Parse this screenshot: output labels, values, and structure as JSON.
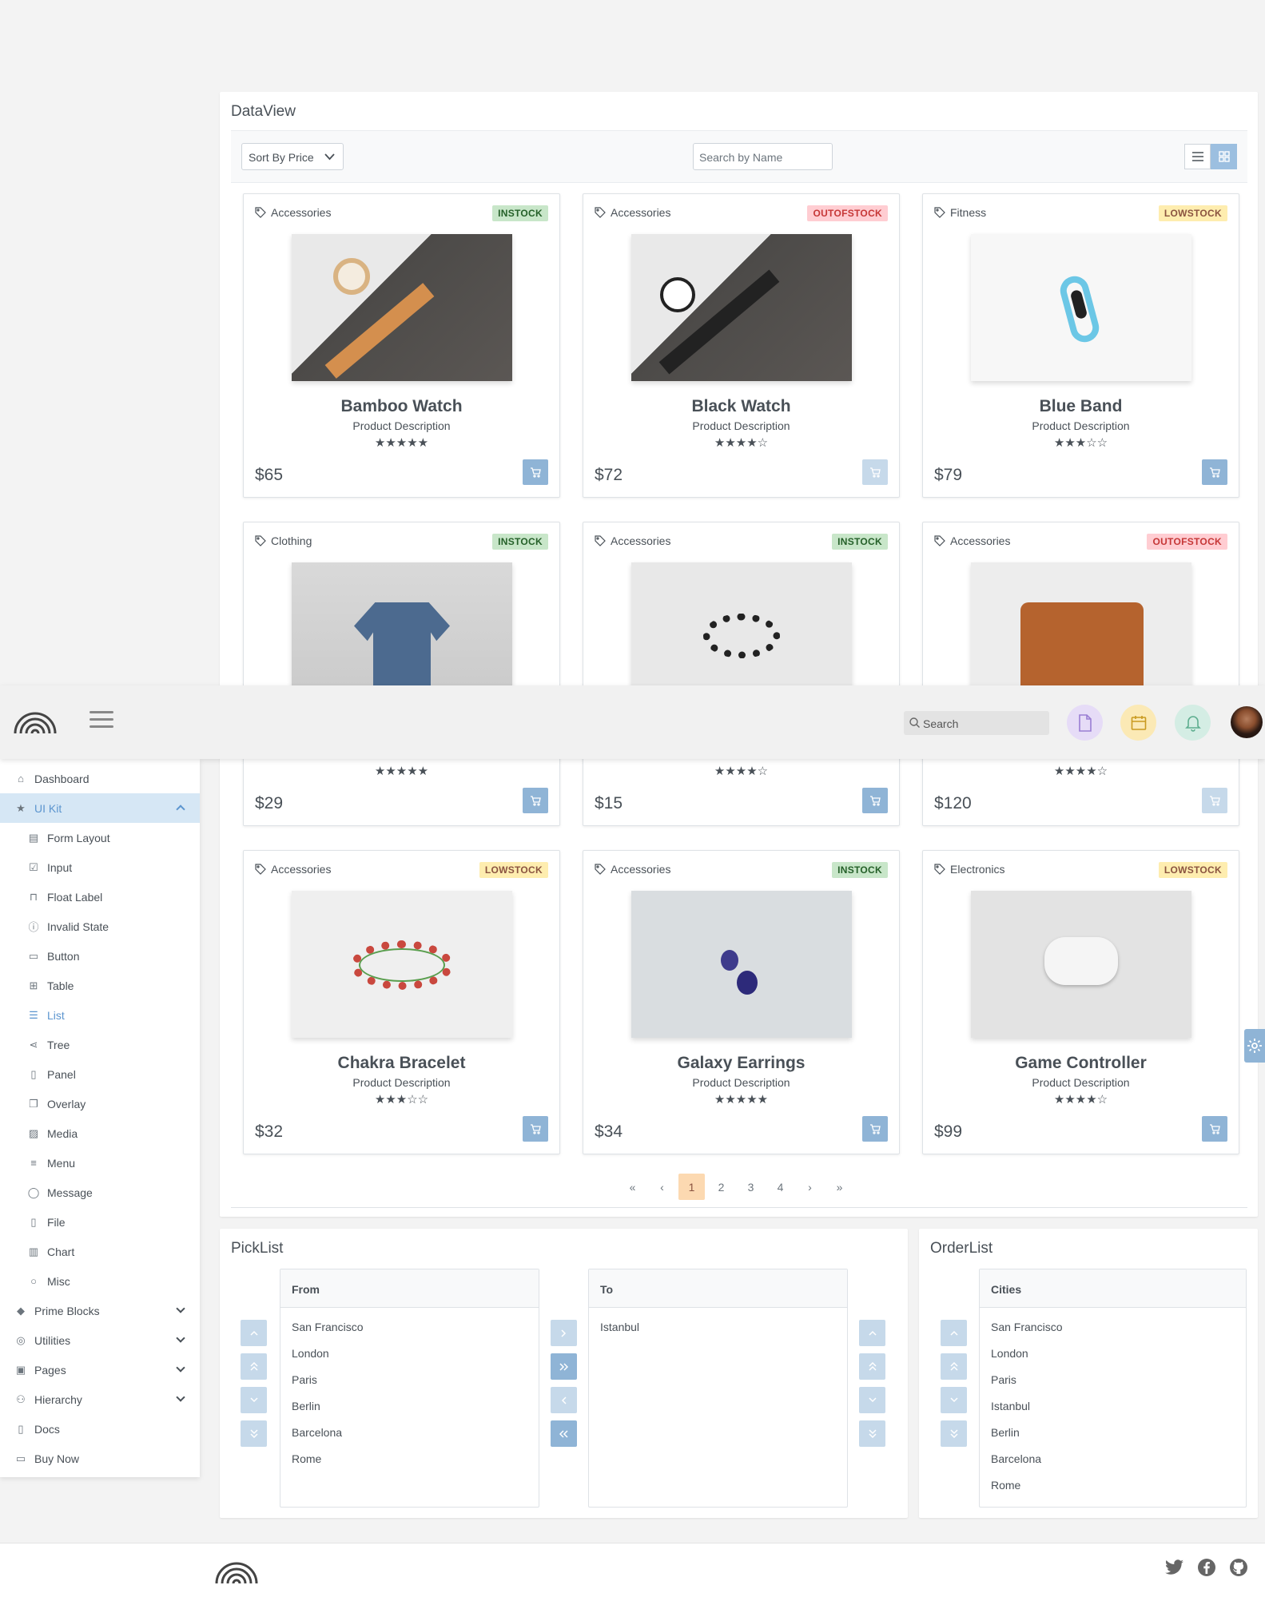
{
  "dataview": {
    "title": "DataView",
    "sort_label": "Sort By Price",
    "search_placeholder": "Search by Name",
    "products": [
      {
        "category": "Accessories",
        "status": "INSTOCK",
        "status_type": "in",
        "name": "Bamboo Watch",
        "description": "Product Description",
        "rating": 5,
        "price": "$65",
        "cart_disabled": false
      },
      {
        "category": "Accessories",
        "status": "OUTOFSTOCK",
        "status_type": "out",
        "name": "Black Watch",
        "description": "Product Description",
        "rating": 4,
        "price": "$72",
        "cart_disabled": true
      },
      {
        "category": "Fitness",
        "status": "LOWSTOCK",
        "status_type": "low",
        "name": "Blue Band",
        "description": "Product Description",
        "rating": 3,
        "price": "$79",
        "cart_disabled": false
      },
      {
        "category": "Clothing",
        "status": "INSTOCK",
        "status_type": "in",
        "name": "",
        "description": "",
        "rating": 5,
        "price": "$29",
        "cart_disabled": false
      },
      {
        "category": "Accessories",
        "status": "INSTOCK",
        "status_type": "in",
        "name": "",
        "description": "",
        "rating": 4,
        "price": "$15",
        "cart_disabled": false
      },
      {
        "category": "Accessories",
        "status": "OUTOFSTOCK",
        "status_type": "out",
        "name": "",
        "description": "",
        "rating": 4,
        "price": "$120",
        "cart_disabled": true
      },
      {
        "category": "Accessories",
        "status": "LOWSTOCK",
        "status_type": "low",
        "name": "Chakra Bracelet",
        "description": "Product Description",
        "rating": 3,
        "price": "$32",
        "cart_disabled": false
      },
      {
        "category": "Accessories",
        "status": "INSTOCK",
        "status_type": "in",
        "name": "Galaxy Earrings",
        "description": "Product Description",
        "rating": 5,
        "price": "$34",
        "cart_disabled": false
      },
      {
        "category": "Electronics",
        "status": "LOWSTOCK",
        "status_type": "low",
        "name": "Game Controller",
        "description": "Product Description",
        "rating": 4,
        "price": "$99",
        "cart_disabled": false
      }
    ],
    "pager": {
      "first": "«",
      "prev": "‹",
      "pages": [
        "1",
        "2",
        "3",
        "4"
      ],
      "current": "1",
      "next": "›",
      "last": "»"
    }
  },
  "topbar": {
    "search_placeholder": "Search"
  },
  "sidebar": {
    "items": [
      {
        "label": "Dashboard",
        "icon": "home-icon",
        "level": 0
      },
      {
        "label": "UI Kit",
        "icon": "star-icon",
        "level": 0,
        "active": true,
        "expandable": true
      },
      {
        "label": "Form Layout",
        "icon": "id-card-icon",
        "level": 1
      },
      {
        "label": "Input",
        "icon": "check-square-icon",
        "level": 1
      },
      {
        "label": "Float Label",
        "icon": "bookmark-icon",
        "level": 1
      },
      {
        "label": "Invalid State",
        "icon": "exclamation-circle-icon",
        "level": 1
      },
      {
        "label": "Button",
        "icon": "mobile-icon",
        "level": 1
      },
      {
        "label": "Table",
        "icon": "table-icon",
        "level": 1
      },
      {
        "label": "List",
        "icon": "list-icon",
        "level": 1,
        "selected": true
      },
      {
        "label": "Tree",
        "icon": "share-alt-icon",
        "level": 1
      },
      {
        "label": "Panel",
        "icon": "tablet-icon",
        "level": 1
      },
      {
        "label": "Overlay",
        "icon": "clone-icon",
        "level": 1
      },
      {
        "label": "Media",
        "icon": "image-icon",
        "level": 1
      },
      {
        "label": "Menu",
        "icon": "bars-icon",
        "level": 1
      },
      {
        "label": "Message",
        "icon": "comment-icon",
        "level": 1
      },
      {
        "label": "File",
        "icon": "file-icon",
        "level": 1
      },
      {
        "label": "Chart",
        "icon": "chart-bar-icon",
        "level": 1
      },
      {
        "label": "Misc",
        "icon": "circle-icon",
        "level": 1
      },
      {
        "label": "Prime Blocks",
        "icon": "prime-icon",
        "level": 0,
        "expandable": true
      },
      {
        "label": "Utilities",
        "icon": "compass-icon",
        "level": 0,
        "expandable": true
      },
      {
        "label": "Pages",
        "icon": "briefcase-icon",
        "level": 0,
        "expandable": true
      },
      {
        "label": "Hierarchy",
        "icon": "sitemap-icon",
        "level": 0,
        "expandable": true
      },
      {
        "label": "Docs",
        "icon": "file-icon",
        "level": 0
      },
      {
        "label": "Buy Now",
        "icon": "money-bill-icon",
        "level": 0
      }
    ]
  },
  "picklist": {
    "title": "PickList",
    "source_header": "From",
    "source_items": [
      "San Francisco",
      "London",
      "Paris",
      "Berlin",
      "Barcelona",
      "Rome"
    ],
    "target_header": "To",
    "target_items": [
      "Istanbul"
    ]
  },
  "orderlist": {
    "title": "OrderList",
    "header": "Cities",
    "items": [
      "San Francisco",
      "London",
      "Paris",
      "Istanbul",
      "Berlin",
      "Barcelona",
      "Rome"
    ]
  },
  "colors": {
    "accent": "#8fb4d6",
    "instock": "#c8e6c9",
    "outofstock": "#ffcdd2",
    "lowstock": "#feedaf"
  }
}
